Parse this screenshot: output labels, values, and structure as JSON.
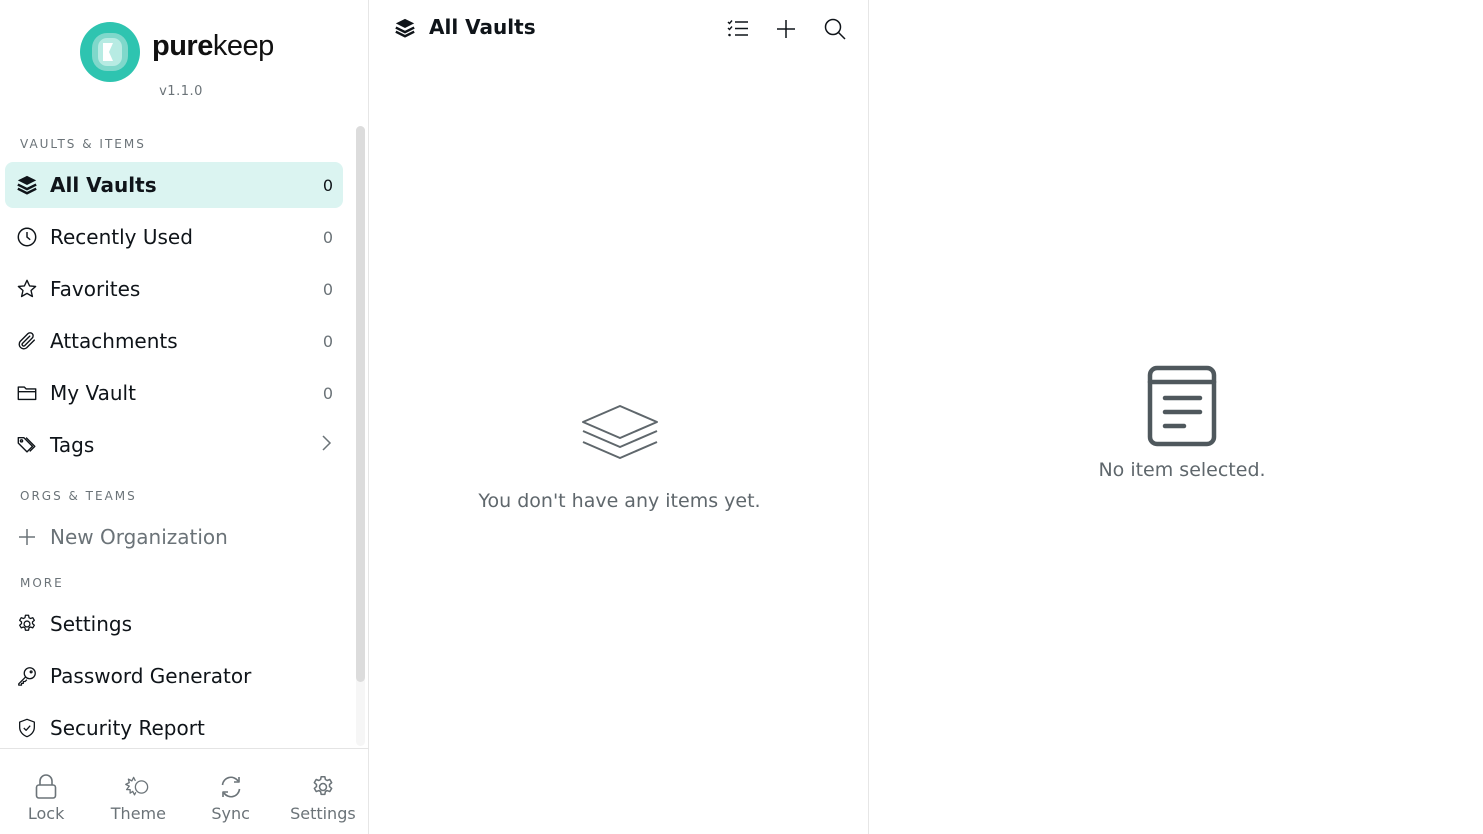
{
  "app": {
    "brand_bold": "pure",
    "brand_light": "keep",
    "version": "v1.1.0",
    "accent_color": "#2ec4b0",
    "active_bg_color": "#dbf4f1"
  },
  "sidebar": {
    "sections": {
      "vaults": "VAULTS & ITEMS",
      "orgs": "ORGS & TEAMS",
      "more": "MORE"
    },
    "vault_items": [
      {
        "label": "All Vaults",
        "count": "0",
        "icon": "layers-icon",
        "active": true
      },
      {
        "label": "Recently Used",
        "count": "0",
        "icon": "clock-icon"
      },
      {
        "label": "Favorites",
        "count": "0",
        "icon": "star-icon"
      },
      {
        "label": "Attachments",
        "count": "0",
        "icon": "paperclip-icon"
      },
      {
        "label": "My Vault",
        "count": "0",
        "icon": "folder-icon"
      },
      {
        "label": "Tags",
        "icon": "tag-icon",
        "trailing": "chevron-right-icon"
      }
    ],
    "org_items": [
      {
        "label": "New Organization",
        "icon": "plus-icon"
      }
    ],
    "more_items": [
      {
        "label": "Settings",
        "icon": "gear-icon"
      },
      {
        "label": "Password Generator",
        "icon": "key-icon"
      },
      {
        "label": "Security Report",
        "icon": "shield-check-icon"
      }
    ]
  },
  "bottom_bar": [
    {
      "label": "Lock",
      "icon": "lock-icon"
    },
    {
      "label": "Theme",
      "icon": "theme-icon"
    },
    {
      "label": "Sync",
      "icon": "sync-icon"
    },
    {
      "label": "Settings",
      "icon": "gear-icon"
    }
  ],
  "list_pane": {
    "title": "All Vaults",
    "actions": [
      "select-icon",
      "plus-icon",
      "search-icon"
    ],
    "empty_text": "You don't have any items yet."
  },
  "detail_pane": {
    "empty_text": "No item selected."
  }
}
